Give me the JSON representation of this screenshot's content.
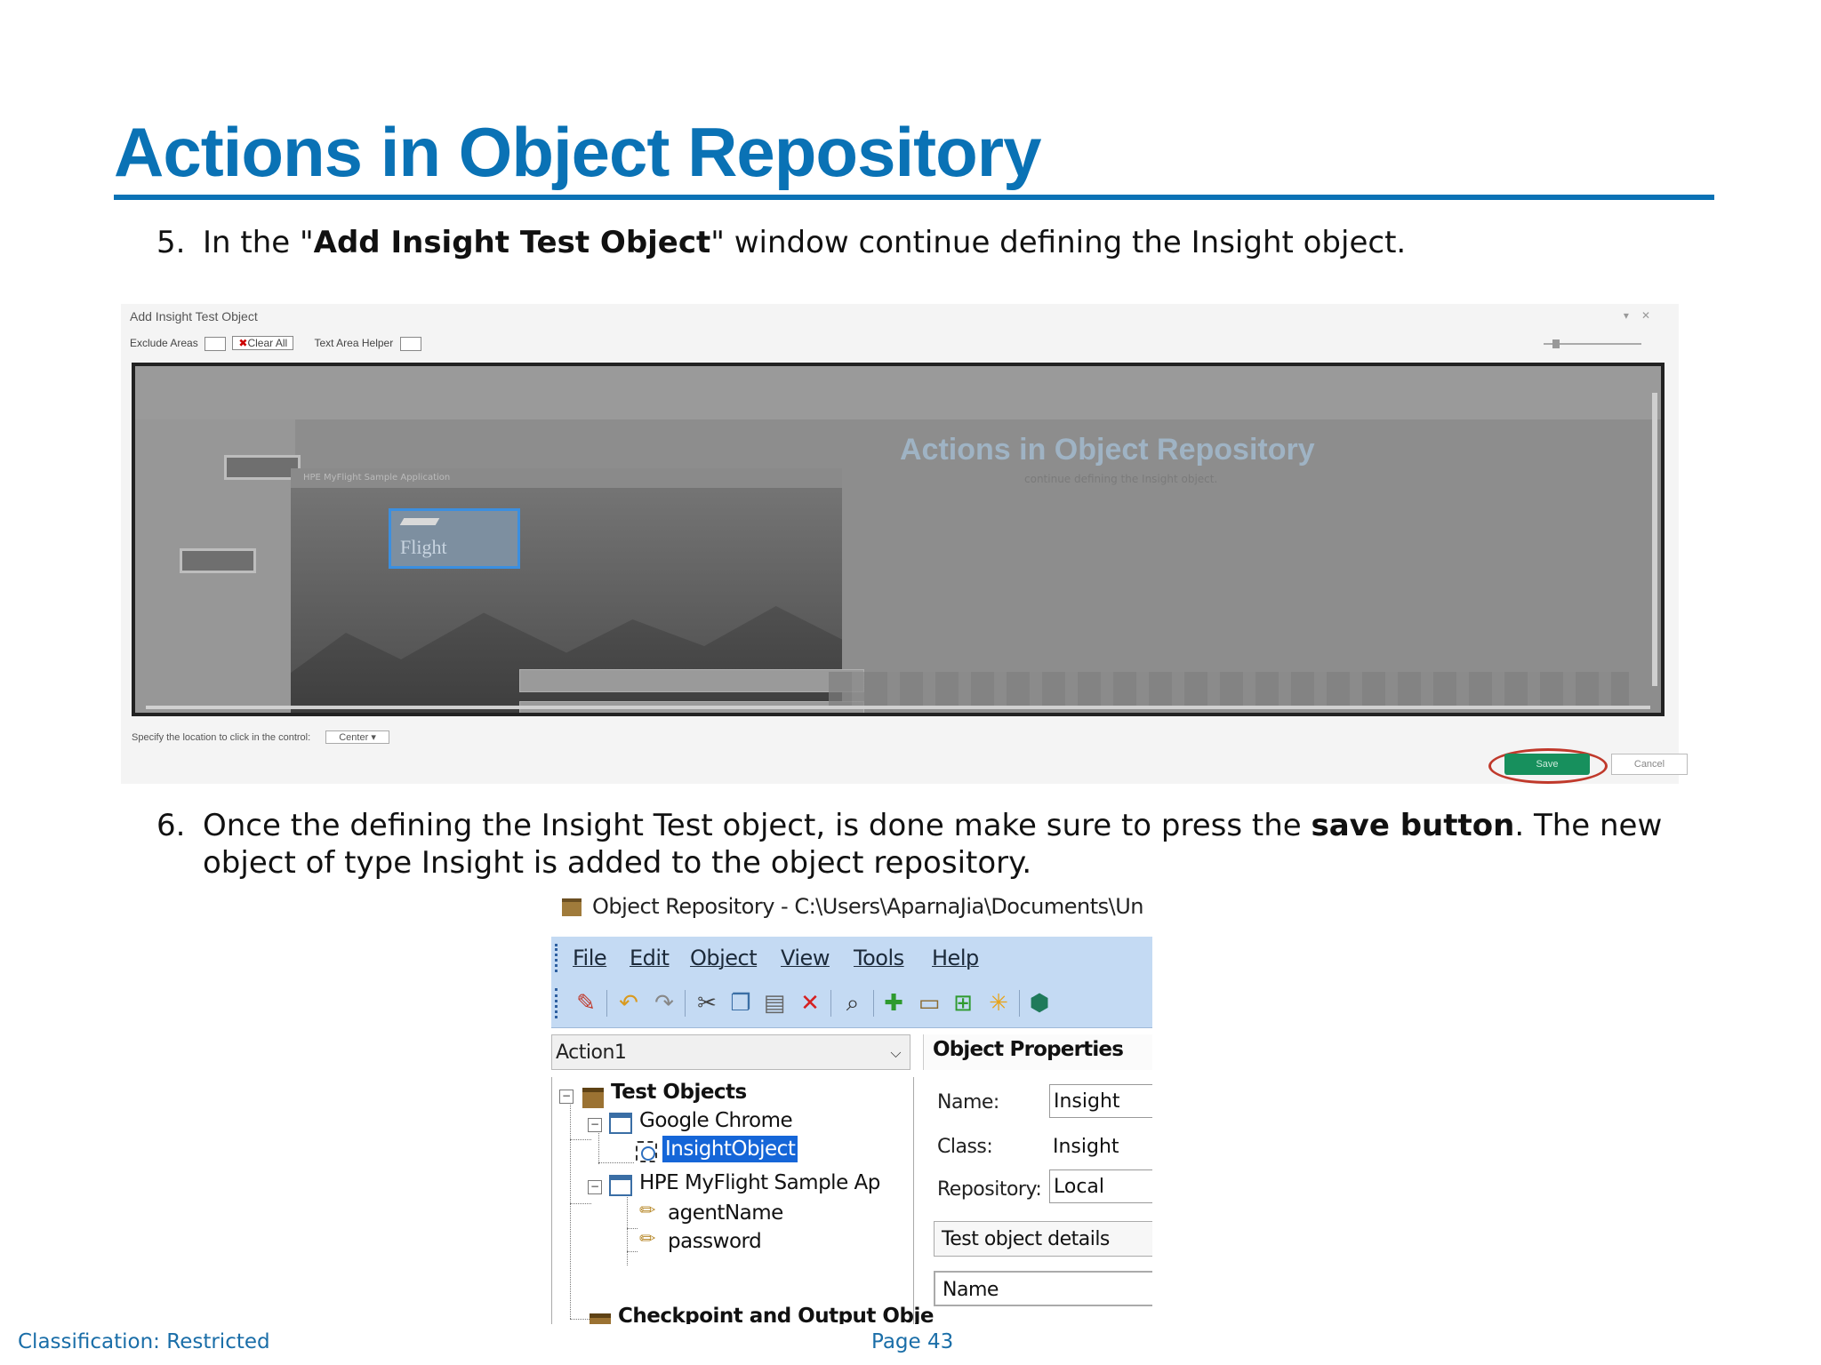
{
  "slide": {
    "title": "Actions in Object Repository",
    "step5": {
      "number": "5.",
      "pre": "In the \"",
      "bold": "Add Insight Test Object",
      "post": "\" window continue defining the Insight object."
    },
    "step6": {
      "number": "6.",
      "pre": "Once the defining the Insight Test object, is done make sure to press the ",
      "bold": "save button",
      "post": ". The new",
      "line2": "object of type Insight is added to the object repository."
    },
    "footer": {
      "classification": "Classification: Restricted",
      "page": "Page 43"
    }
  },
  "add_insight_window": {
    "title": "Add Insight Test Object",
    "exclude_areas_label": "Exclude Areas",
    "clear_all_label": "Clear All",
    "text_area_helper_label": "Text Area Helper",
    "bg_title": "Actions in Object Repository",
    "bg_subtitle": "continue defining the Insight object.",
    "app_title": "HPE MyFlight Sample Application",
    "logo_text": "Flight",
    "click_location_label": "Specify the location to click in the control:",
    "click_location_value": "Center",
    "save_label": "Save",
    "cancel_label": "Cancel",
    "accent_color": "#17905d",
    "highlight_color": "#c0392b"
  },
  "object_repository": {
    "window_title": "Object Repository - C:\\Users\\AparnaJia\\Documents\\Un",
    "menu": [
      "File",
      "Edit",
      "Object",
      "View",
      "Tools",
      "Help"
    ],
    "toolbar_icons": [
      "record-icon",
      "undo-icon",
      "redo-icon",
      "cut-icon",
      "copy-icon",
      "paste-icon",
      "delete-icon",
      "find-icon",
      "add-object-icon",
      "add-repository-icon",
      "add-insight-icon",
      "highlight-icon",
      "export-icon"
    ],
    "action_combo": "Action1",
    "tree": {
      "test_objects": "Test Objects",
      "google_chrome": "Google Chrome",
      "insight_object": "InsightObject",
      "hpe_app": "HPE MyFlight Sample Ap",
      "agent_name": "agentName",
      "password": "password",
      "checkpoint": "Checkpoint and Output Obje"
    },
    "properties": {
      "header": "Object Properties",
      "name_label": "Name:",
      "name_value": "Insight",
      "class_label": "Class:",
      "class_value": "Insight",
      "repository_label": "Repository:",
      "repository_value": "Local",
      "details_tab": "Test object details",
      "name_column": "Name"
    },
    "selection_color": "#1566d8",
    "menubar_color": "#c4daf3"
  }
}
